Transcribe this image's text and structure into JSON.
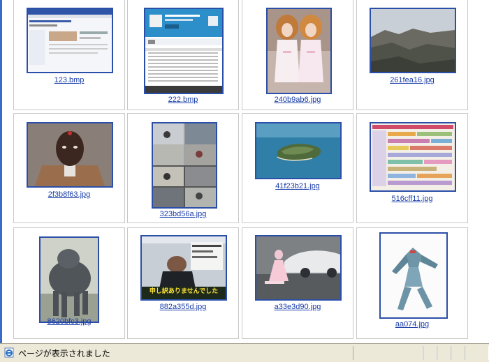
{
  "gallery": {
    "items": [
      {
        "filename": "123.bmp",
        "icon": "browser-screenshot-thumbnail"
      },
      {
        "filename": "222.bmp",
        "icon": "music-playlist-screenshot-thumbnail"
      },
      {
        "filename": "240b9ab6.jpg",
        "icon": "two-dolls-photo-thumbnail"
      },
      {
        "filename": "261fea16.jpg",
        "icon": "mountain-landscape-thumbnail"
      },
      {
        "filename": "2f3b8f63.jpg",
        "icon": "man-portrait-thumbnail"
      },
      {
        "filename": "323bd56a.jpg",
        "icon": "train-collage-thumbnail"
      },
      {
        "filename": "41f23b21.jpg",
        "icon": "island-aerial-thumbnail"
      },
      {
        "filename": "516cff11.jpg",
        "icon": "timeline-chart-thumbnail"
      },
      {
        "filename": "8620bfc3.jpg",
        "icon": "dog-photo-thumbnail"
      },
      {
        "filename": "882a355d.jpg",
        "icon": "tv-screenshot-thumbnail"
      },
      {
        "filename": "a33e3d90.jpg",
        "icon": "car-show-photo-thumbnail"
      },
      {
        "filename": "aa074.jpg",
        "icon": "robot-figure-thumbnail"
      }
    ],
    "tv_caption_text": "申し訳ありませんでした"
  },
  "statusbar": {
    "text": "ページが表示されました",
    "icon": "ie-page-icon"
  },
  "colors": {
    "link": "#1a3ea8",
    "thumb_border": "#2b4fa8",
    "statusbar_bg": "#ece9d8"
  }
}
